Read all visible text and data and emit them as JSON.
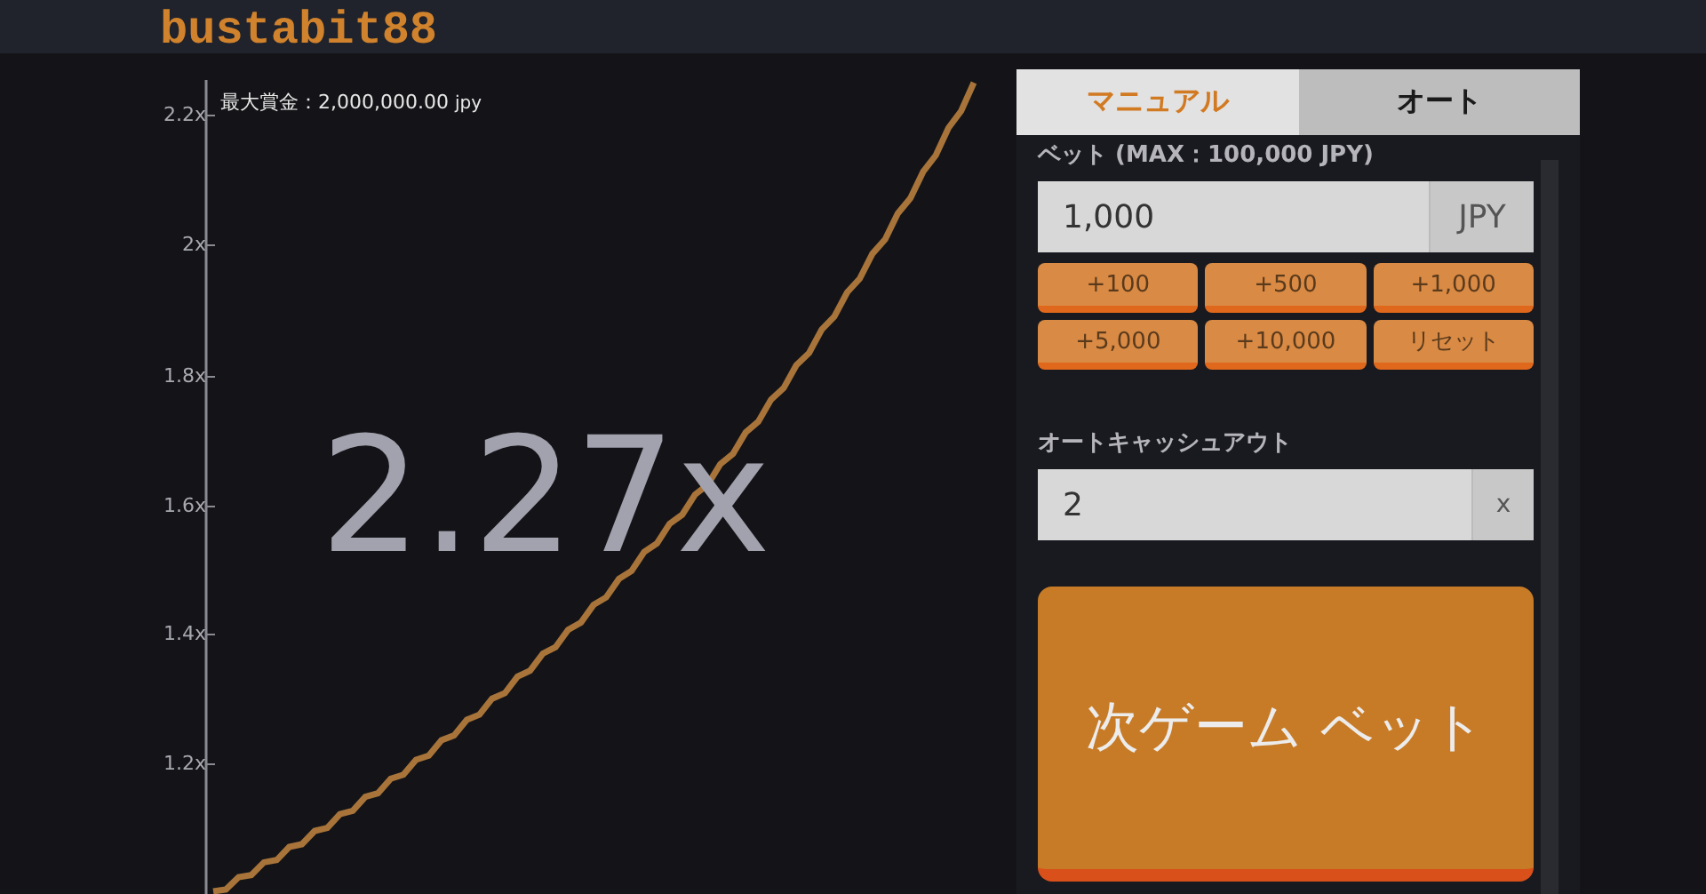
{
  "header": {
    "logo": "bustabit88"
  },
  "game": {
    "max_prize": "最大賞金：2,000,000.00",
    "max_prize_unit": "jpy",
    "multiplier": "2.27x",
    "y_ticks": [
      "2.2x",
      "2x",
      "1.8x",
      "1.6x",
      "1.4x",
      "1.2x"
    ]
  },
  "panel": {
    "tabs": [
      {
        "label": "マニュアル",
        "selected": true
      },
      {
        "label": "オート",
        "selected": false
      }
    ],
    "bet_label": "ベット (MAX：100,000 JPY)",
    "bet_value": "1,000",
    "bet_unit": "JPY",
    "quick_buttons": [
      "+100",
      "+500",
      "+1,000",
      "+5,000",
      "+10,000",
      "リセット"
    ],
    "cashout_label": "オートキャッシュアウト",
    "cashout_value": "2",
    "cashout_unit": "x",
    "bet_button": "次ゲーム ベット"
  }
}
